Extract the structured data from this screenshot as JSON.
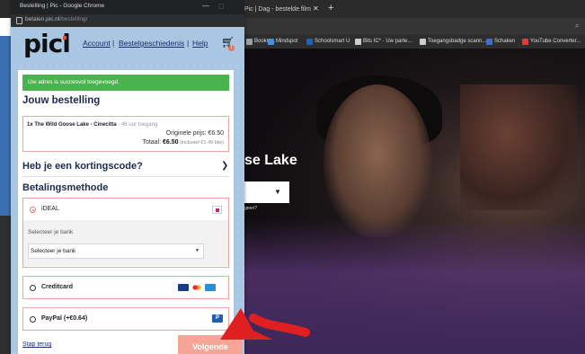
{
  "background_browser": {
    "tab_title": "Pic | Dag - bestelde film",
    "tab_close": "✕",
    "new_tab": "+",
    "bookmarks": [
      {
        "label": "Bookm...",
        "color": "#9aa0a6"
      },
      {
        "label": "Mindspot",
        "color": "#4a8fe0"
      },
      {
        "label": "Schoolsmart U",
        "color": "#1b63b8"
      },
      {
        "label": "Bits IC* · Uw parte...",
        "color": "#cccccc"
      },
      {
        "label": "Toegangsbadge scann...",
        "color": "#cccccc"
      },
      {
        "label": "Schaken",
        "color": "#3d6fd0"
      },
      {
        "label": "YouTube Converter...",
        "color": "#e53935"
      }
    ],
    "hero": {
      "title": "se Lake",
      "small_text": "geen?"
    }
  },
  "popup": {
    "window_title": "Bestelling | Pic - Google Chrome",
    "url_host": "betalen.pic.nl",
    "url_path": "/bestelling/",
    "header": {
      "logo": "picl",
      "nav": [
        "Account",
        "Bestelgeschiedenis",
        "Help"
      ],
      "separator": "|",
      "cart_count": "1"
    },
    "success_message": "Uw adres is succesvol toegevoegd.",
    "order": {
      "heading": "Jouw bestelling",
      "item": "1x The Wild Goose Lake - Cinecitta",
      "item_meta": " - 46 uur toegang",
      "original_price": "Originele prijs: €6.50",
      "total_label": "Totaal: ",
      "total_value": "€6.50",
      "total_note": " (inclusief €1.49 btw)"
    },
    "discount_heading": "Heb je een kortingscode?",
    "payment": {
      "heading": "Betalingsmethode",
      "options": [
        {
          "label": "iDEAL",
          "selected": true
        },
        {
          "label": "Creditcard",
          "selected": false
        },
        {
          "label": "PayPal (+€0.64)",
          "selected": false
        }
      ],
      "bank_label": "Selecteer je bank",
      "bank_select_value": "Selecteer je bank",
      "pp_letter": "P"
    },
    "back_link": "Stap terug",
    "next_button": "Volgende"
  },
  "colors": {
    "success": "#4ab34e",
    "accent": "#f4a596",
    "page_bg": "#a9c7e2",
    "annotation_arrow": "#e02020"
  }
}
